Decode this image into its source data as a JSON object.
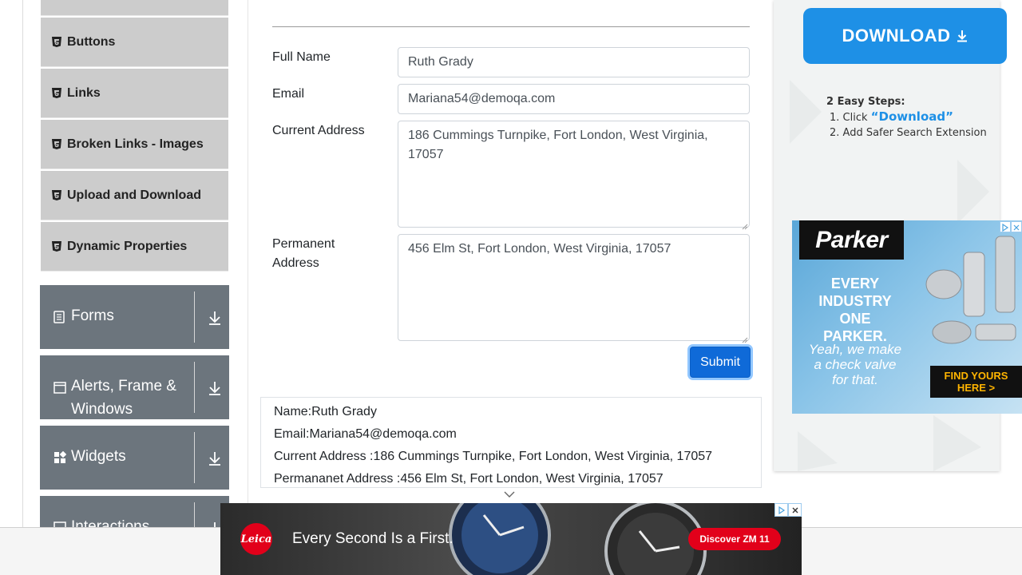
{
  "sidebar": {
    "elements_items": [
      {
        "label": "Buttons"
      },
      {
        "label": "Links"
      },
      {
        "label": "Broken Links - Images"
      },
      {
        "label": "Upload and Download"
      },
      {
        "label": "Dynamic Properties"
      }
    ],
    "groups": [
      {
        "label": "Forms"
      },
      {
        "label": "Alerts, Frame & Windows"
      },
      {
        "label": "Widgets"
      },
      {
        "label": "Interactions"
      }
    ]
  },
  "form": {
    "full_name_label": "Full Name",
    "full_name_value": "Ruth Grady",
    "email_label": "Email",
    "email_value": "Mariana54@demoqa.com",
    "current_address_label": "Current Address",
    "current_address_value": "186 Cummings Turnpike, Fort London, West Virginia, 17057",
    "permanent_address_label": "Permanent Address",
    "permanent_address_value": "456 Elm St, Fort London, West Virginia, 17057",
    "submit_label": "Submit"
  },
  "output": {
    "name": "Name:Ruth Grady",
    "email": "Email:Mariana54@demoqa.com",
    "current_address": "Current Address :186 Cummings Turnpike, Fort London, West Virginia, 17057",
    "permanent_address": "Permananet Address :456 Elm St, Fort London, West Virginia, 17057"
  },
  "right_ad": {
    "download_label": "DOWNLOAD",
    "steps_title": "2 Easy Steps:",
    "step1_prefix": "1. Click ",
    "step1_highlight": "“Download”",
    "step2": "2. Add Safer Search Extension"
  },
  "parker_ad": {
    "logo": "Parker",
    "headline": "EVERY INDUSTRY ONE PARKER.",
    "subline": "Yeah, we make a check valve for that.",
    "cta": "FIND YOURS HERE >"
  },
  "bottom_ad": {
    "logo": "Leica",
    "tagline": "Every Second Is a First.",
    "cta": "Discover ZM 11"
  },
  "colors": {
    "sidebar_item_bg": "#cccccc",
    "group_bg": "#6c757d",
    "submit_bg": "#0f6ad8",
    "download_bg": "#1e90e6",
    "leica_red": "#e2001a"
  }
}
